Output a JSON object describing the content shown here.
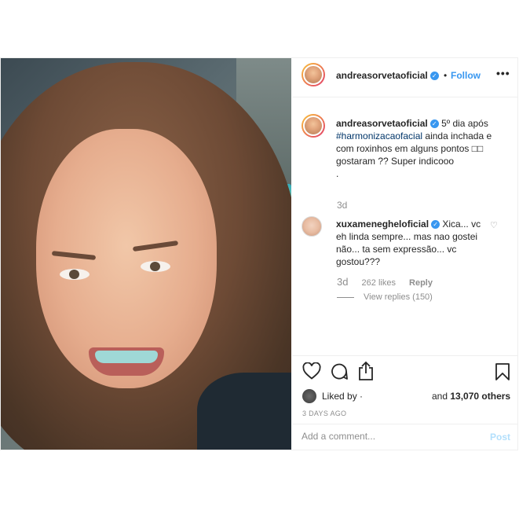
{
  "header": {
    "username": "andreasorvetaoficial",
    "verified_icon": "verified-check-icon",
    "separator": "•",
    "follow_label": "Follow",
    "more_label": "•••"
  },
  "caption": {
    "username": "andreasorvetaoficial",
    "text_before": "5º dia após",
    "hashtag": "#harmonizacaofacial",
    "text_after": "ainda inchada e com roxinhos em alguns pontos □□ gostaram ?? Super indicooo",
    "dots": ".",
    "time": "3d"
  },
  "comment": {
    "username": "xuxamenegheloficial",
    "text": "Xica... vc eh linda sempre... mas nao gostei não... ta sem expressão... vc gostou???",
    "time": "3d",
    "likes": "262 likes",
    "reply_label": "Reply",
    "view_replies": "View replies (150)"
  },
  "actions": {
    "liked_by": "Liked by",
    "liked_by_user": "·",
    "and_label": "and",
    "others": "13,070 others",
    "date": "3 DAYS AGO"
  },
  "add_comment": {
    "placeholder": "Add a comment...",
    "post_label": "Post"
  },
  "colors": {
    "link_blue": "#3897f0",
    "hashtag": "#003569",
    "muted": "#8e8e8e",
    "post_disabled": "#b2dffc"
  }
}
